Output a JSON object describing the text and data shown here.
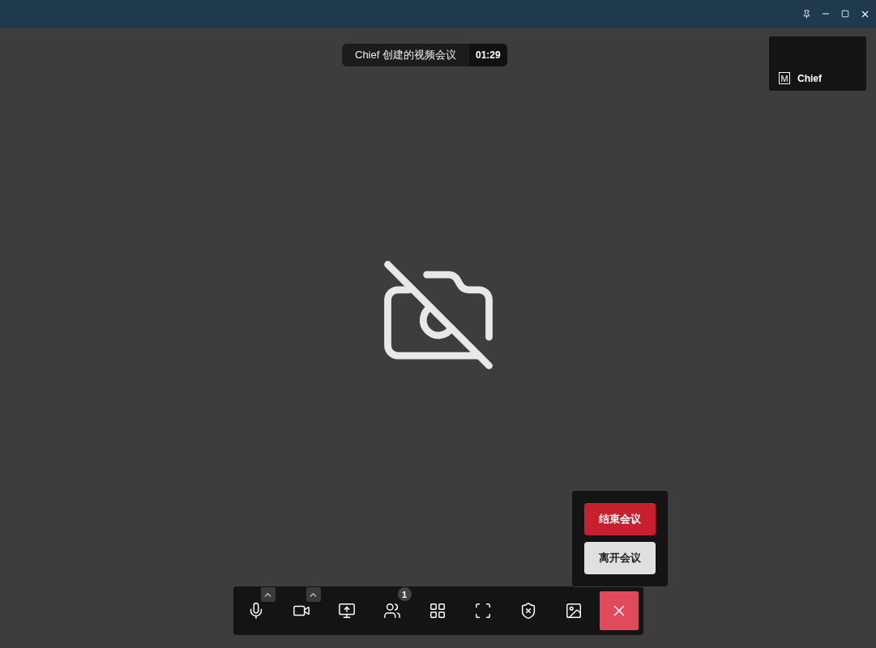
{
  "meeting_header": {
    "title": "Chief 创建的视频会议",
    "duration": "01:29"
  },
  "self_view": {
    "badge": "M",
    "name": "Chief"
  },
  "toolbar": [
    {
      "kind": "mic",
      "has_menu": true
    },
    {
      "kind": "camera",
      "has_menu": true
    },
    {
      "kind": "share"
    },
    {
      "kind": "participants",
      "count": "1"
    },
    {
      "kind": "layout"
    },
    {
      "kind": "fullscreen"
    },
    {
      "kind": "security"
    },
    {
      "kind": "background"
    },
    {
      "kind": "leave"
    }
  ],
  "leave_menu": [
    {
      "label": "结束会议",
      "kind": "danger"
    },
    {
      "label": "离开会议",
      "kind": "neutral"
    }
  ]
}
